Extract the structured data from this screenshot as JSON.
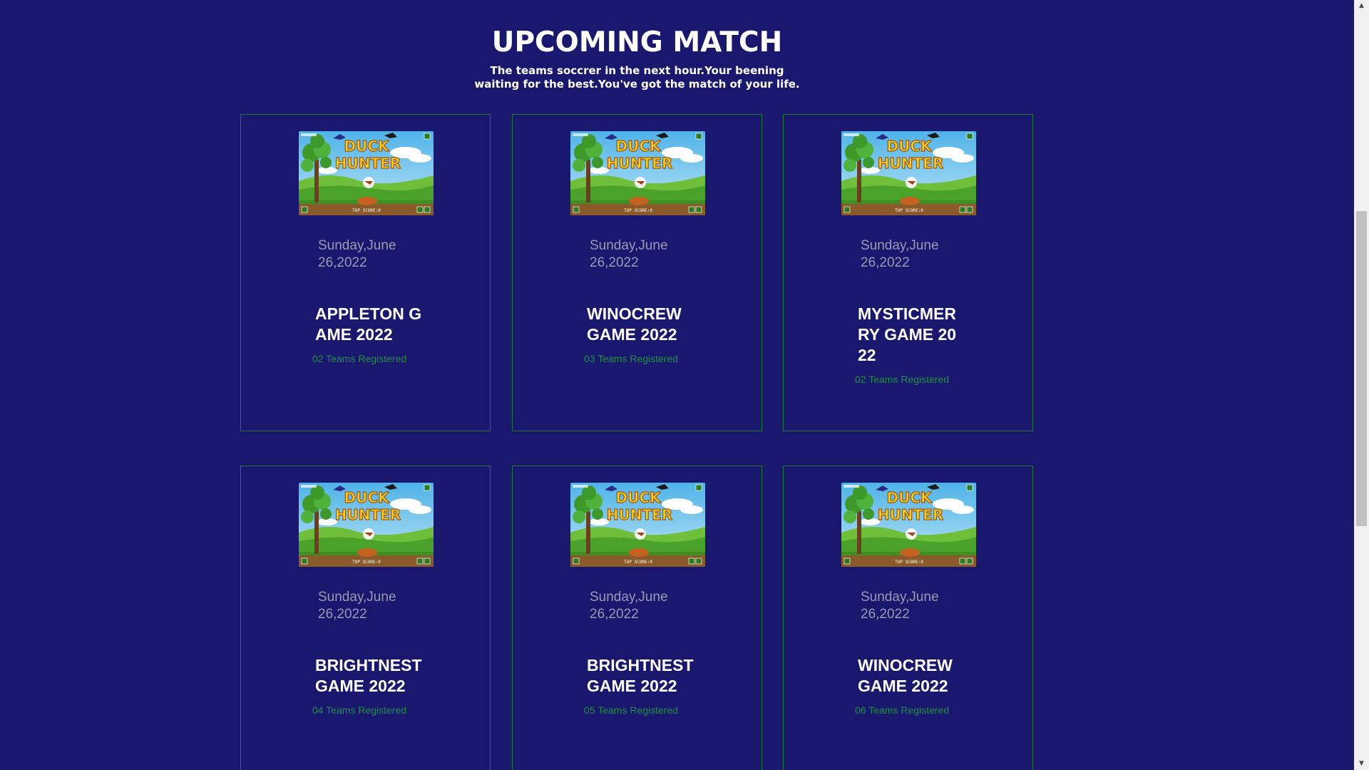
{
  "header": {
    "title": "UPCOMING MATCH",
    "subtitle": "The teams soccrer in the next hour.Your beening waiting for the best.You've got the match of your life."
  },
  "matches": [
    {
      "image_alt": "Duck Hunter game art",
      "date": "Sunday,June 26,2022",
      "name": "APPLETON GAME 2022",
      "teams": "02 Teams Registered"
    },
    {
      "image_alt": "Duck Hunter game art",
      "date": "Sunday,June 26,2022",
      "name": "WINOCREW GAME 2022",
      "teams": "03 Teams Registered"
    },
    {
      "image_alt": "Duck Hunter game art",
      "date": "Sunday,June 26,2022",
      "name": "MYSTICMERRY GAME 2022",
      "teams": "02 Teams Registered"
    },
    {
      "image_alt": "Duck Hunter game art",
      "date": "Sunday,June 26,2022",
      "name": "BRIGHTNEST GAME 2022",
      "teams": "04 Teams Registered"
    },
    {
      "image_alt": "Duck Hunter game art",
      "date": "Sunday,June 26,2022",
      "name": "BRIGHTNEST GAME 2022",
      "teams": "05 Teams Registered"
    },
    {
      "image_alt": "Duck Hunter game art",
      "date": "Sunday,June 26,2022",
      "name": "WINOCREW GAME 2022",
      "teams": "06 Teams Registered"
    }
  ],
  "thumbnail": {
    "logo_line1": "DUCK",
    "logo_line2": "HUNTER",
    "footer": "TOP SCORE:0"
  },
  "colors": {
    "background": "#19186e",
    "card_border": "#1f7a3a",
    "teams_text": "#1f8f45",
    "date_text": "#9a9ab4"
  },
  "scrollbar": {
    "up_icon": "triangle-up-icon",
    "down_icon": "triangle-down-icon"
  }
}
